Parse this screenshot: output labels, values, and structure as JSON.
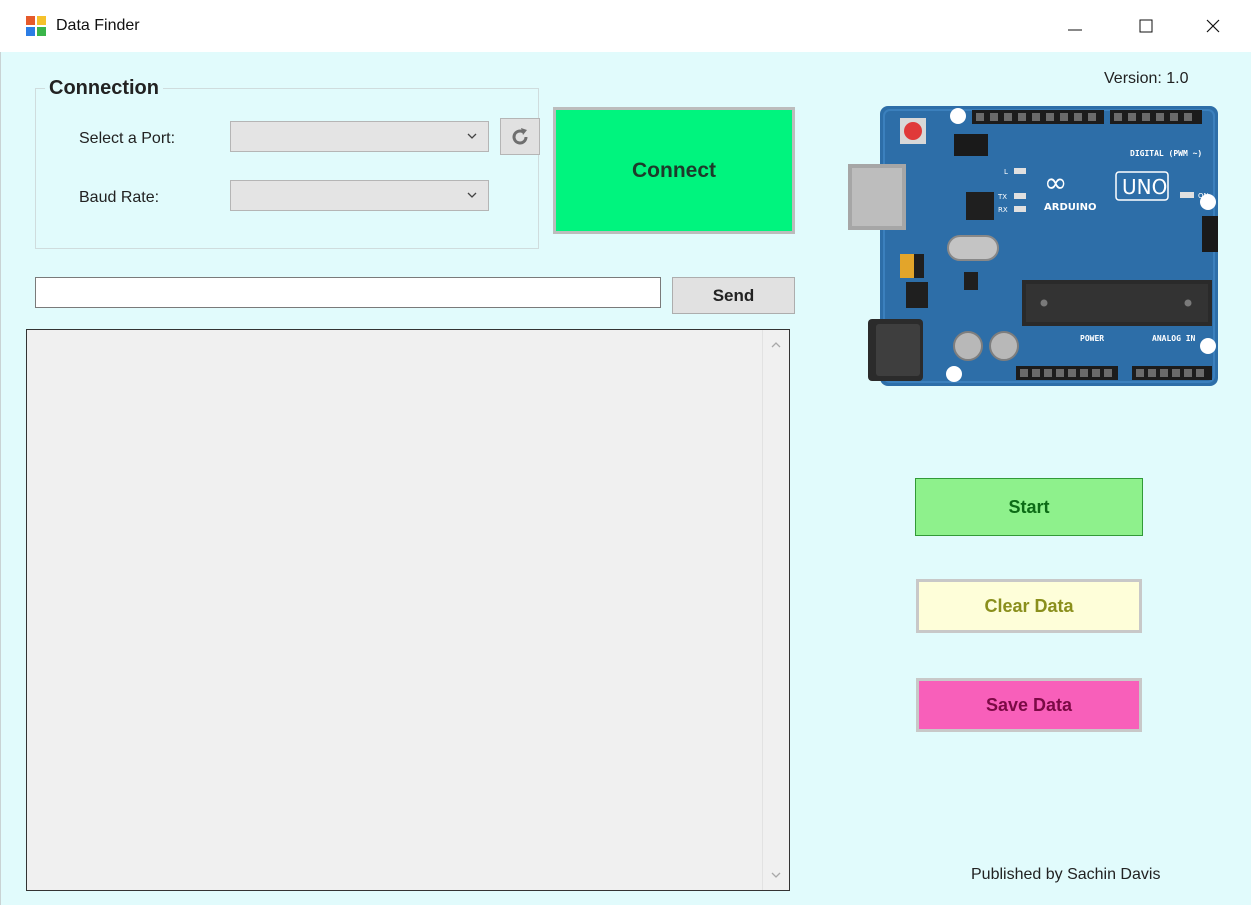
{
  "window": {
    "title": "Data Finder",
    "controls": {
      "minimize": "minimize",
      "maximize": "maximize",
      "close": "close"
    }
  },
  "version_text": "Version: 1.0",
  "connection": {
    "legend": "Connection",
    "port_label": "Select a Port:",
    "port_value": "",
    "baud_label": "Baud Rate:",
    "baud_value": "",
    "connect_label": "Connect"
  },
  "send": {
    "input_value": "",
    "button_label": "Send"
  },
  "output_text": "",
  "board": {
    "labels": {
      "uno": "UNO",
      "brand": "ARDUINO",
      "digital": "DIGITAL (PWM ~)",
      "power": "POWER",
      "analog": "ANALOG IN",
      "on": "ON",
      "l": "L",
      "tx": "TX",
      "rx": "RX"
    }
  },
  "actions": {
    "start_label": "Start",
    "clear_label": "Clear Data",
    "save_label": "Save Data"
  },
  "footer_text": "Published by Sachin Davis",
  "colors": {
    "client_bg": "#e1fbfc",
    "connect": "#00f47e",
    "start": "#8ef18c",
    "clear": "#fefed9",
    "save": "#f85fba",
    "board": "#2d6ea8"
  }
}
